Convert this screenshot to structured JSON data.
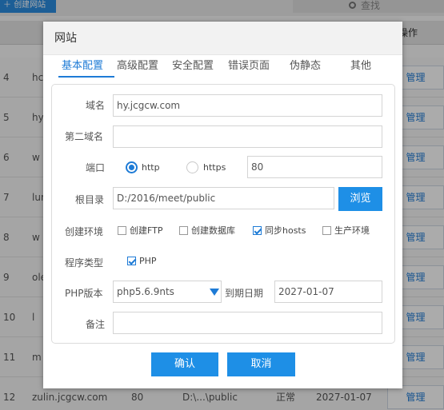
{
  "background": {
    "create_site_label": "创建网站",
    "search_label": "查找",
    "column_ops": "操作",
    "manage_label": "管理",
    "rows": [
      {
        "num": "4",
        "domain": "hc",
        "port": "",
        "dir": "",
        "status": "",
        "expiry": ""
      },
      {
        "num": "5",
        "domain": "hy",
        "port": "",
        "dir": "",
        "status": "",
        "expiry": ""
      },
      {
        "num": "6",
        "domain": "w",
        "port": "",
        "dir": "",
        "status": "",
        "expiry": ""
      },
      {
        "num": "7",
        "domain": "lun",
        "port": "",
        "dir": "",
        "status": "",
        "expiry": ""
      },
      {
        "num": "8",
        "domain": "w",
        "port": "",
        "dir": "",
        "status": "",
        "expiry": ""
      },
      {
        "num": "9",
        "domain": "ole",
        "port": "",
        "dir": "",
        "status": "",
        "expiry": ""
      },
      {
        "num": "10",
        "domain": "l",
        "port": "",
        "dir": "",
        "status": "",
        "expiry": ""
      },
      {
        "num": "11",
        "domain": "m",
        "port": "",
        "dir": "",
        "status": "",
        "expiry": ""
      },
      {
        "num": "12",
        "domain": "zulin.jcgcw.com",
        "port": "80",
        "dir": "D:\\...\\public",
        "status": "正常",
        "expiry": "2027-01-07"
      }
    ]
  },
  "dialog": {
    "title": "网站",
    "tabs": [
      {
        "label": "基本配置",
        "active": true
      },
      {
        "label": "高级配置",
        "active": false
      },
      {
        "label": "安全配置",
        "active": false
      },
      {
        "label": "错误页面",
        "active": false
      },
      {
        "label": "伪静态",
        "active": false
      },
      {
        "label": "其他",
        "active": false
      }
    ],
    "form": {
      "domain_label": "域名",
      "domain_value": "hy.jcgcw.com",
      "second_domain_label": "第二域名",
      "second_domain_value": "",
      "port_label": "端口",
      "http_label": "http",
      "https_label": "https",
      "port_value": "80",
      "root_label": "根目录",
      "root_value": "D:/2016/meet/public",
      "browse_label": "浏览",
      "env_label": "创建环境",
      "env_options": [
        {
          "label": "创建FTP",
          "checked": false
        },
        {
          "label": "创建数据库",
          "checked": false
        },
        {
          "label": "同步hosts",
          "checked": true
        },
        {
          "label": "生产环境",
          "checked": false
        }
      ],
      "program_type_label": "程序类型",
      "program_type_option": "PHP",
      "program_type_checked": true,
      "php_version_label": "PHP版本",
      "php_version_value": "php5.6.9nts",
      "expiry_label": "到期日期",
      "expiry_value": "2027-01-07",
      "note_label": "备注",
      "note_value": ""
    },
    "confirm_label": "确认",
    "cancel_label": "取消"
  },
  "colors": {
    "accent": "#1e8fe6",
    "link": "#1e7bd6"
  }
}
